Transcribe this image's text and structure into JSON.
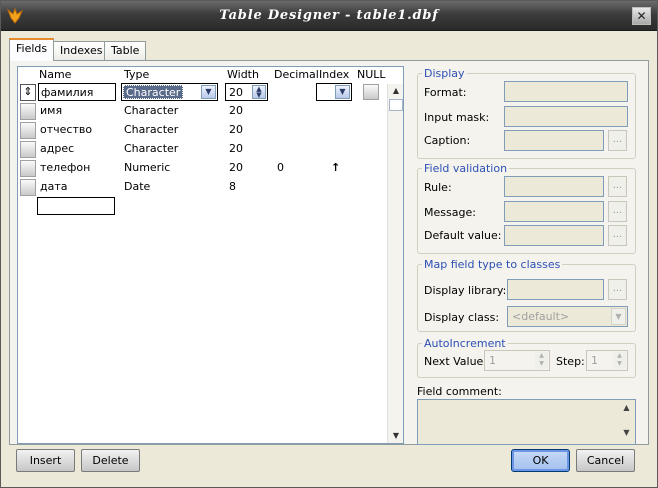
{
  "window": {
    "title": "Table Designer - table1.dbf",
    "close_label": "✕"
  },
  "tabs": [
    "Fields",
    "Indexes",
    "Table"
  ],
  "grid": {
    "headers": {
      "name": "Name",
      "type": "Type",
      "width": "Width",
      "decimal": "Decimal",
      "index": "Index",
      "null": "NULL"
    },
    "current_row": {
      "name": "фамилия",
      "type": "Character",
      "width": "20",
      "handle_glyph": "⇕"
    },
    "rows": [
      {
        "name": "имя",
        "type": "Character",
        "width": "20",
        "decimal": "",
        "index": ""
      },
      {
        "name": "отчество",
        "type": "Character",
        "width": "20",
        "decimal": "",
        "index": ""
      },
      {
        "name": "адрес",
        "type": "Character",
        "width": "20",
        "decimal": "",
        "index": ""
      },
      {
        "name": "телефон",
        "type": "Numeric",
        "width": "20",
        "decimal": "0",
        "index": "↑"
      },
      {
        "name": "дата",
        "type": "Date",
        "width": "8",
        "decimal": "",
        "index": ""
      }
    ]
  },
  "display": {
    "title": "Display",
    "format_label": "Format:",
    "input_mask_label": "Input mask:",
    "caption_label": "Caption:",
    "ellipsis": "..."
  },
  "validation": {
    "title": "Field validation",
    "rule_label": "Rule:",
    "message_label": "Message:",
    "default_label": "Default value:"
  },
  "map": {
    "title": "Map field type to classes",
    "library_label": "Display library:",
    "class_label": "Display class:",
    "class_value": "<default>"
  },
  "autoinc": {
    "title": "AutoIncrement",
    "next_label": "Next Value:",
    "next_value": "1",
    "step_label": "Step:",
    "step_value": "1"
  },
  "comment": {
    "label": "Field comment:"
  },
  "buttons": {
    "insert": "Insert",
    "delete": "Delete",
    "ok": "OK",
    "cancel": "Cancel"
  }
}
